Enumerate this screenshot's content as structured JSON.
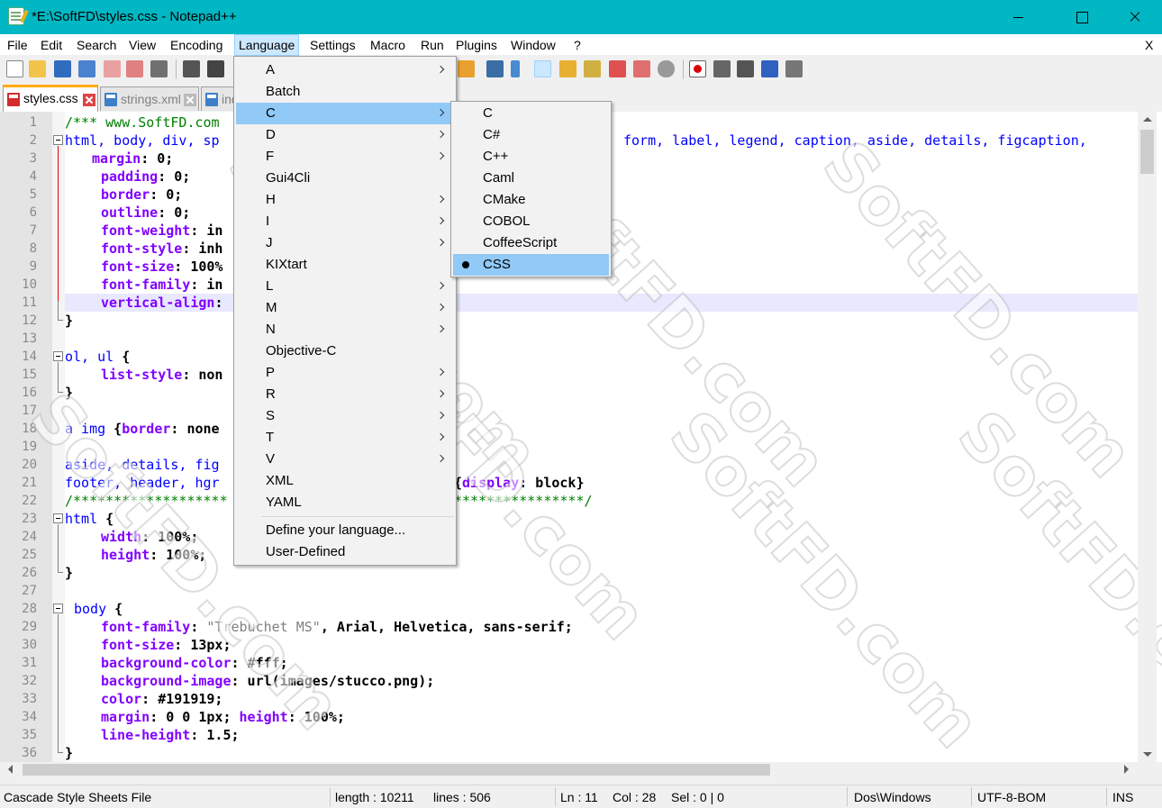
{
  "window": {
    "title": "*E:\\SoftFD\\styles.css - Notepad++"
  },
  "menubar": {
    "items": [
      "File",
      "Edit",
      "Search",
      "View",
      "Encoding",
      "Language",
      "Settings",
      "Macro",
      "Run",
      "Plugins",
      "Window",
      "?"
    ],
    "active": "Language",
    "close_label": "X"
  },
  "tabs": [
    {
      "label": "styles.css",
      "active": true,
      "modified": true
    },
    {
      "label": "strings.xml",
      "active": false,
      "modified": false
    },
    {
      "label": "ind",
      "active": false,
      "modified": false
    }
  ],
  "editor": {
    "line_numbers": [
      "1",
      "2",
      "3",
      "4",
      "5",
      "6",
      "7",
      "8",
      "9",
      "10",
      "11",
      "12",
      "13",
      "14",
      "15",
      "16",
      "17",
      "18",
      "19",
      "20",
      "21",
      "22",
      "23",
      "24",
      "25",
      "26",
      "27",
      "28",
      "29",
      "30",
      "31",
      "32",
      "33",
      "34",
      "35",
      "36"
    ],
    "current_line": 11
  },
  "language_menu": {
    "items": [
      {
        "label": "A",
        "submenu": true
      },
      {
        "label": "Batch",
        "submenu": false
      },
      {
        "label": "C",
        "submenu": true,
        "highlighted": true
      },
      {
        "label": "D",
        "submenu": true
      },
      {
        "label": "F",
        "submenu": true
      },
      {
        "label": "Gui4Cli",
        "submenu": false
      },
      {
        "label": "H",
        "submenu": true
      },
      {
        "label": "I",
        "submenu": true
      },
      {
        "label": "J",
        "submenu": true
      },
      {
        "label": "KIXtart",
        "submenu": false
      },
      {
        "label": "L",
        "submenu": true
      },
      {
        "label": "M",
        "submenu": true
      },
      {
        "label": "N",
        "submenu": true
      },
      {
        "label": "Objective-C",
        "submenu": false
      },
      {
        "label": "P",
        "submenu": true
      },
      {
        "label": "R",
        "submenu": true
      },
      {
        "label": "S",
        "submenu": true
      },
      {
        "label": "T",
        "submenu": true
      },
      {
        "label": "V",
        "submenu": true
      },
      {
        "label": "XML",
        "submenu": false
      },
      {
        "label": "YAML",
        "submenu": false
      }
    ],
    "footer_items": [
      "Define your language...",
      "User-Defined"
    ]
  },
  "c_submenu": {
    "items": [
      "C",
      "C#",
      "C++",
      "Caml",
      "CMake",
      "COBOL",
      "CoffeeScript",
      "CSS"
    ],
    "selected": "CSS"
  },
  "statusbar": {
    "file_type": "Cascade Style Sheets File",
    "length": "length : 10211",
    "lines": "lines : 506",
    "ln": "Ln : 11",
    "col": "Col : 28",
    "sel": "Sel : 0 | 0",
    "eol": "Dos\\Windows",
    "encoding": "UTF-8-BOM",
    "mode": "INS"
  },
  "code": {
    "l1": "/*** www.SoftFD.com",
    "l2a": "html, body, div, sp",
    "l2b": "form, label, legend, caption, aside, details, figcaption,",
    "l3p": "margin",
    "l3v": ": 0;",
    "l4p": "padding",
    "l4v": ": 0;",
    "l5p": "border",
    "l5v": ": 0;",
    "l6p": "outline",
    "l6v": ": 0;",
    "l7p": "font-weight",
    "l7v": ": in",
    "l8p": "font-style",
    "l8v": ": inh",
    "l9p": "font-size",
    "l9v": ": 100%",
    "l10p": "font-family",
    "l10v": ": in",
    "l11p": "vertical-align",
    "l11v": ":",
    "brace_close": "}",
    "l14s": "ol, ul",
    "l14b": " {",
    "l15p": "list-style",
    "l15v": ": non",
    "l18s": "a img",
    "l18b": " {",
    "l18p": "border",
    "l18v": ": none",
    "l20s": "aside, details, fig",
    "l21s": "footer, header, hgr",
    "l21b": "{",
    "l21p": "display",
    "l21v": ": block}",
    "l22a": "/*******************",
    "l22b": "****************/",
    "l23s": "html",
    "l23b": " {",
    "l24p": "width",
    "l24v": ": 100%;",
    "l25p": "height",
    "l25v": ": 100%;",
    "l28s": "body",
    "l28b": " {",
    "l29p": "font-family",
    "l29v1": ": ",
    "l29str": "\"Trebuchet MS\"",
    "l29v2": ", Arial, Helvetica, sans-serif;",
    "l30p": "font-size",
    "l30v": ": 13px;",
    "l31p": "background-color",
    "l31v": ": #fff;",
    "l32p": "background-image",
    "l32v": ": url(images/stucco.png);",
    "l33p": "color",
    "l33v": ": #191919;",
    "l34p": "margin",
    "l34v": ": 0 0 1px; ",
    "l34p2": "height",
    "l34v2": ": 100%;",
    "l35p": "line-height",
    "l35v": ": 1.5;"
  },
  "watermark": "SoftFD.com"
}
